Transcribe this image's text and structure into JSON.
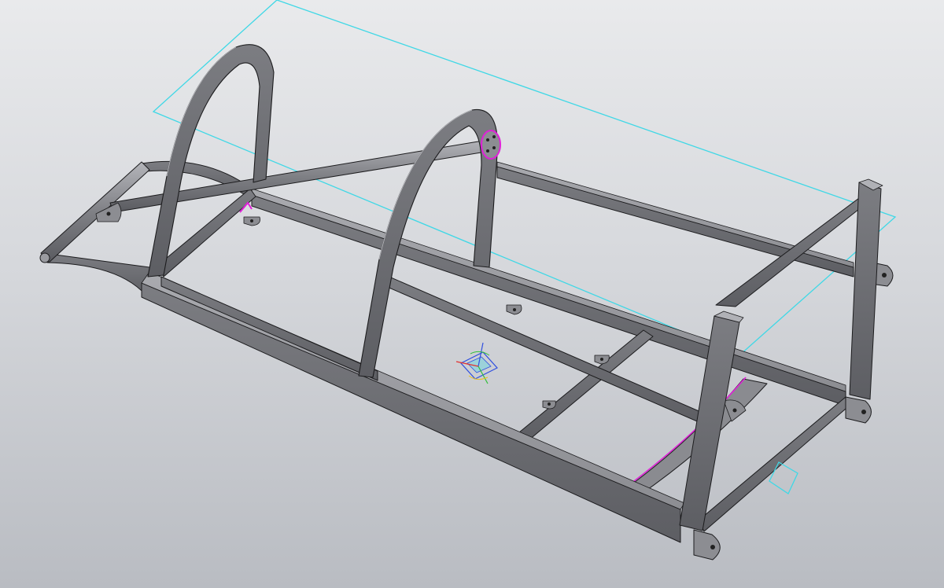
{
  "viewport": {
    "view_kind": "3D model viewport",
    "colors": {
      "background_top": "#e9eaec",
      "background_bottom": "#b9bcc2",
      "steel_face_dark": "#6a6b70",
      "steel_face_mid": "#8a8b90",
      "steel_face_light": "#a8a9ae",
      "edge": "#1c1c1e",
      "construction_plane": "#3fd8e6",
      "selection_highlight": "#e020d8",
      "axis_x": "#e23030",
      "axis_y": "#2fbf3a",
      "axis_z": "#2f4fe0"
    },
    "icons": {
      "origin_triad": "coordinate-triad-icon",
      "plane_marker": "plane-marker-icon"
    }
  }
}
